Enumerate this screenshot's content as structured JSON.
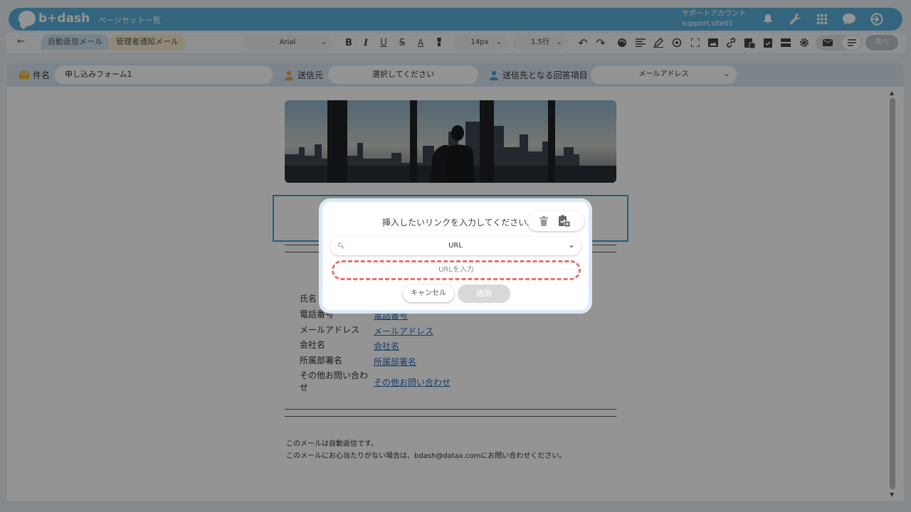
{
  "header": {
    "logo_text": "b+dash",
    "nav_link": "ページセット一覧",
    "account_name": "サポートアカウント",
    "account_site": "support.site01"
  },
  "toolbar": {
    "tab_auto_reply": "自動返信メール",
    "tab_admin_notify": "管理者通知メール",
    "font_family": "Arial",
    "font_size": "14px",
    "line_height": "1.5行",
    "next_label": "次へ"
  },
  "fields": {
    "subject_label": "件名",
    "subject_value": "申し込みフォーム1",
    "sender_label": "送信元",
    "sender_placeholder": "選択してください",
    "recipient_label": "送信先となる回答項目",
    "recipient_value": "メールアドレス"
  },
  "email_body": {
    "form_rows": [
      {
        "label": "氏名",
        "value": ""
      },
      {
        "label": "電話番号",
        "value": "電話番号"
      },
      {
        "label": "メールアドレス",
        "value": "メールアドレス"
      },
      {
        "label": "会社名",
        "value": "会社名"
      },
      {
        "label": "所属部署名",
        "value": "所属部署名"
      },
      {
        "label": "その他お問い合わ",
        "label2": "せ",
        "value": "その他お問い合わせ"
      }
    ],
    "footer_line1": "このメールは自動返信です。",
    "footer_line2": "このメールにお心当たりがない場合は、bdash@datax.comにお問い合わせください。"
  },
  "dialog": {
    "title": "挿入したいリンクを入力してください。",
    "link_type": "URL",
    "url_placeholder": "URLを入力",
    "cancel_label": "キャンセル",
    "apply_label": "適用"
  },
  "colors": {
    "brand_blue": "#5aaed9",
    "selection_border": "#3aa0d8",
    "input_highlight": "#e57373",
    "link": "#2a6fb5"
  }
}
